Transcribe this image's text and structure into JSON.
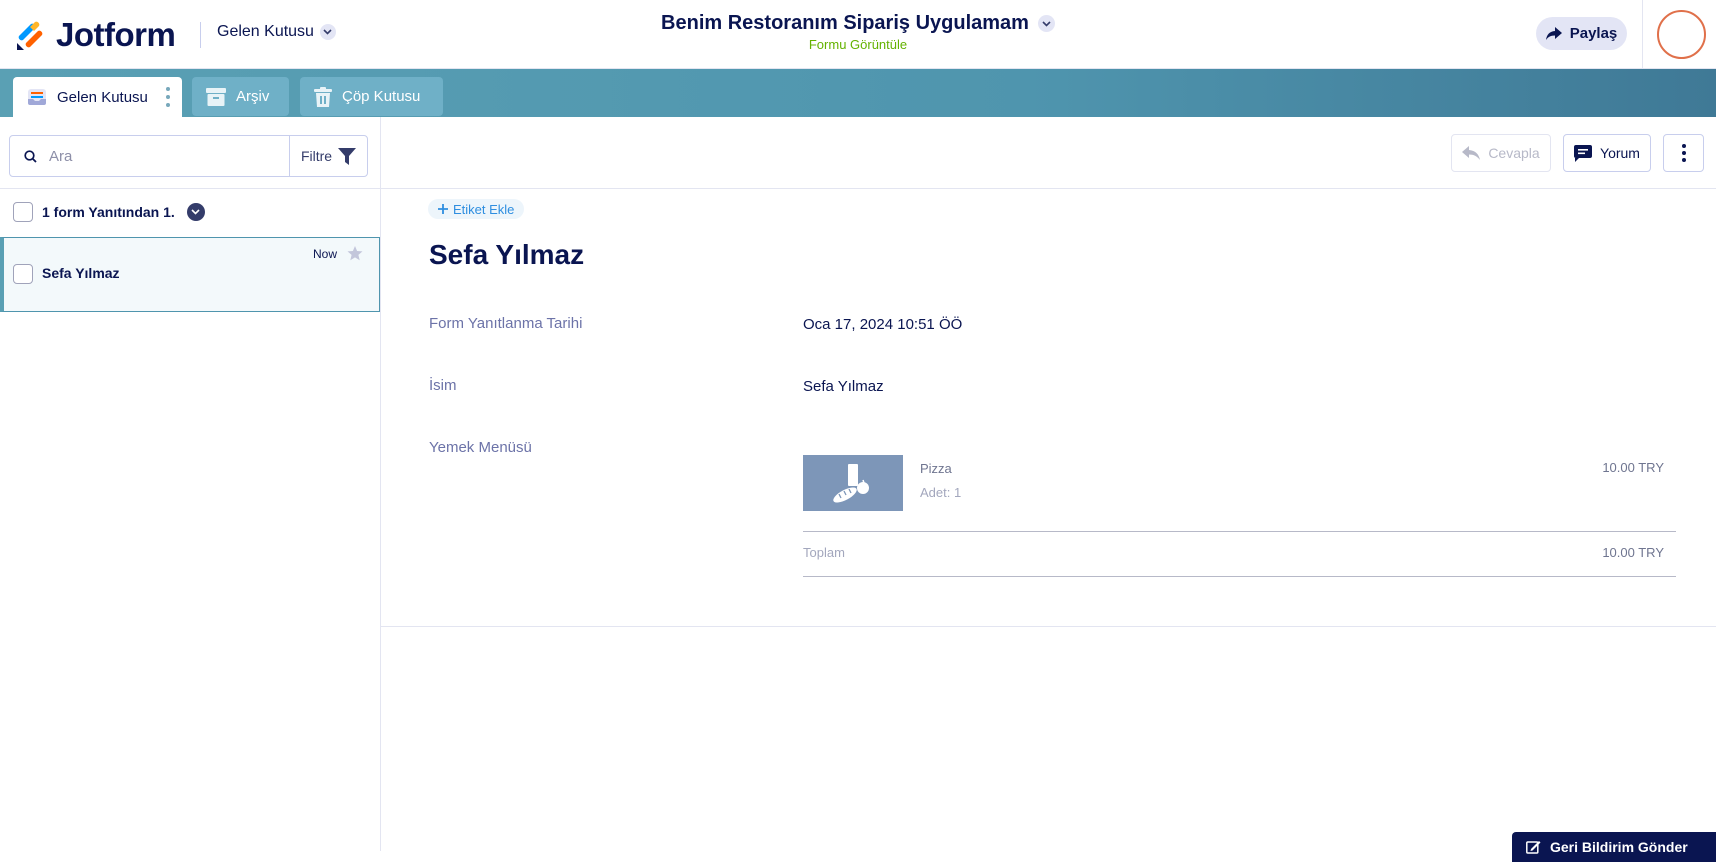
{
  "header": {
    "logo_text": "Jotform",
    "inbox_switch_label": "Gelen Kutusu",
    "form_title": "Benim Restoranım Sipariş Uygulamam",
    "view_form_link": "Formu Görüntüle",
    "share_label": "Paylaş"
  },
  "tabs": [
    {
      "label": "Gelen Kutusu",
      "active": true,
      "icon": "inbox-icon"
    },
    {
      "label": "Arşiv",
      "active": false,
      "icon": "archive-icon"
    },
    {
      "label": "Çöp Kutusu",
      "active": false,
      "icon": "trash-icon"
    }
  ],
  "sidebar": {
    "search_placeholder": "Ara",
    "filter_label": "Filtre",
    "list_header": "1 form Yanıtından 1.",
    "submissions": [
      {
        "name": "Sefa Yılmaz",
        "time": "Now",
        "starred": false,
        "selected": true
      }
    ]
  },
  "toolbar": {
    "reply_label": "Cevapla",
    "comment_label": "Yorum"
  },
  "submission": {
    "add_tag_label": "Etiket Ekle",
    "title": "Sefa Yılmaz",
    "fields": [
      {
        "label": "Form Yanıtlanma Tarihi",
        "value": "Oca 17, 2024 10:51 ÖÖ"
      },
      {
        "label": "İsim",
        "value": "Sefa Yılmaz"
      },
      {
        "label": "Yemek Menüsü",
        "value": ""
      }
    ],
    "order": {
      "items": [
        {
          "name": "Pizza",
          "quantity": "Adet: 1",
          "price": "10.00 TRY"
        }
      ],
      "total_label": "Toplam",
      "total_value": "10.00 TRY"
    }
  },
  "feedback_label": "Geri Bildirim Gönder",
  "colors": {
    "navy": "#0a1551",
    "tab_bar": "#4f95ae",
    "view_form_green": "#64b200",
    "avatar_ring": "#e0704a"
  }
}
